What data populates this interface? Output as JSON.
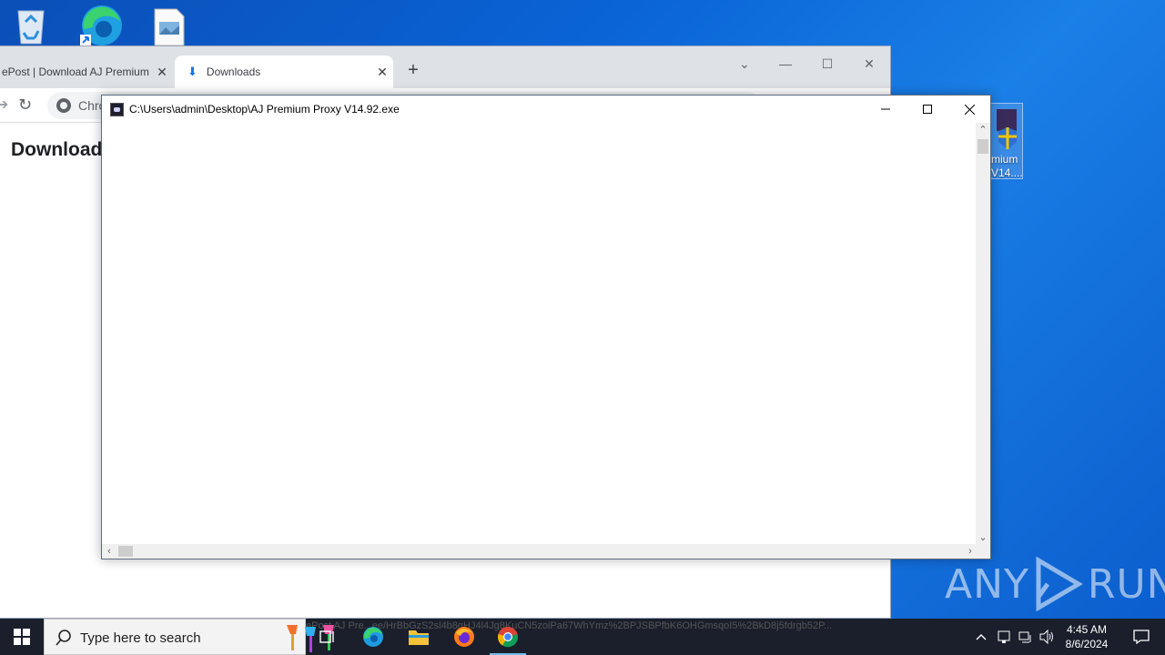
{
  "desktop": {
    "selected_icon_label": "mium\nV14...."
  },
  "chrome": {
    "tabs": [
      {
        "title": "ePost | Download AJ Premium",
        "close": "✕"
      },
      {
        "title": "Downloads",
        "close": "✕"
      }
    ],
    "new_tab": "+",
    "controls": {
      "dropdown": "⌄",
      "minimize": "—",
      "maximize": "☐",
      "close": "✕"
    },
    "omnibox_text": "Chro",
    "page_heading": "Download"
  },
  "console": {
    "title": "C:\\Users\\admin\\Desktop\\AJ Premium Proxy V14.92.exe"
  },
  "watermark": {
    "left": "ANY",
    "right": "RUN"
  },
  "taskbar": {
    "search_placeholder": "Type here to search",
    "url_strip": "ePost AJ Pre...ee/HrBbGzS2sl4b8qHJ4l4Jg8KuCN5zoiPa67WhYmz%2BPJSBPfbK6OHGmsqoI5%2BkD8j5fdrgb52P...",
    "clock_time": "4:45 AM",
    "clock_date": "8/6/2024"
  },
  "colors": {
    "desktop_bg": "#0a64d6",
    "taskbar_bg": "#1a1f2b",
    "chrome_tabstrip": "#dee1e6",
    "chrome_accent": "#1a73e8"
  }
}
